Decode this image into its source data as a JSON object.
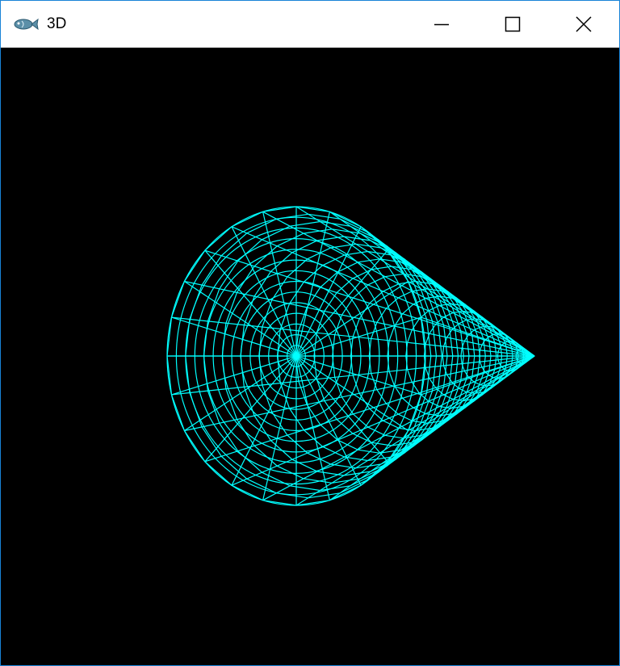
{
  "window": {
    "title": "3D",
    "icon": "fish-app-icon",
    "controls": {
      "minimize_icon": "minimize-icon",
      "maximize_icon": "maximize-icon",
      "close_icon": "close-icon"
    }
  },
  "colors": {
    "canvas_background": "#000000",
    "wireframe": "#00ffff",
    "window_border": "#1883d7"
  },
  "scene": {
    "object": "cone",
    "render_mode": "wireframe",
    "rings": 20,
    "slices": 24
  }
}
